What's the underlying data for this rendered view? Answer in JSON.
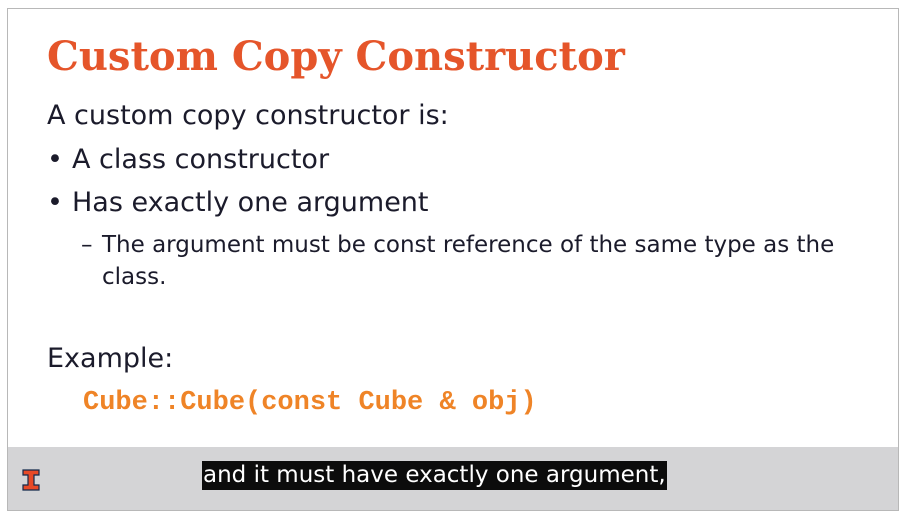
{
  "slide": {
    "title": "Custom Copy Constructor",
    "intro": "A custom copy constructor is:",
    "bullets": [
      {
        "marker": "•",
        "text": "A class constructor"
      },
      {
        "marker": "•",
        "text": "Has exactly one argument"
      }
    ],
    "sub_bullet": {
      "marker": "–",
      "text": "The argument must be const reference of the same type as the class."
    },
    "example_label": "Example:",
    "code": "Cube::Cube(const Cube & obj)"
  },
  "footer": {
    "logo_icon": "illinois-block-i-logo",
    "caption": "and it must have exactly one argument,"
  },
  "colors": {
    "title": "#e5552a",
    "code": "#ef8427",
    "body_text": "#1b1b2b",
    "footer_bg": "#d4d4d6",
    "caption_bg": "#0c0c0c",
    "logo_orange": "#e84a27"
  }
}
